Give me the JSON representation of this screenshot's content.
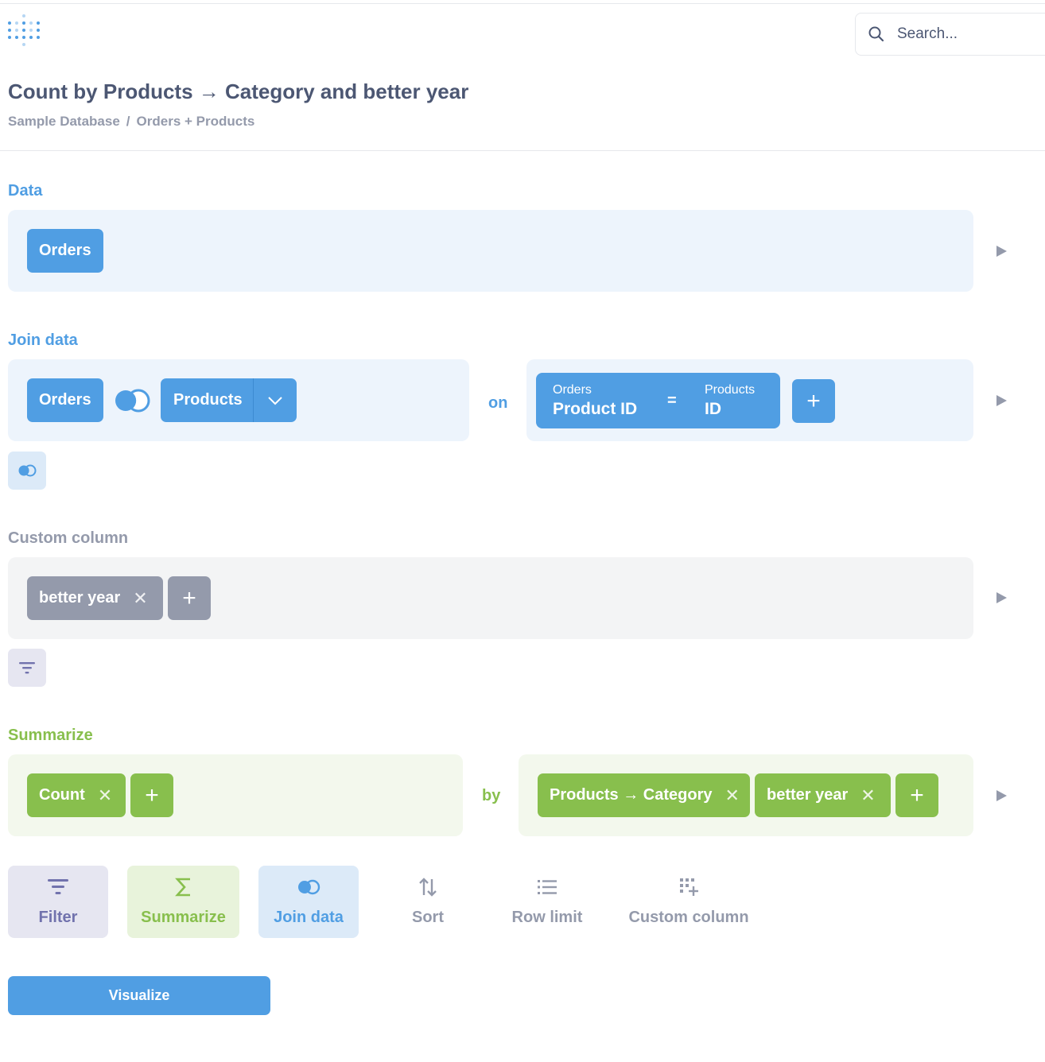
{
  "header": {
    "search_placeholder": "Search...",
    "title": "Count by Products → Category and better year",
    "breadcrumb": [
      "Sample Database",
      "/",
      "Orders + Products"
    ]
  },
  "data_section": {
    "label": "Data",
    "source": "Orders"
  },
  "join_section": {
    "label": "Join data",
    "left_table": "Orders",
    "right_table": "Products",
    "on_label": "on",
    "condition": {
      "left_table": "Orders",
      "left_field": "Product ID",
      "operator": "=",
      "right_table": "Products",
      "right_field": "ID"
    },
    "add_label": "+"
  },
  "custom_column_section": {
    "label": "Custom column",
    "columns": [
      "better year"
    ],
    "add_label": "+"
  },
  "summarize_section": {
    "label": "Summarize",
    "metrics": [
      "Count"
    ],
    "by_label": "by",
    "breakouts": [
      "Products → Category",
      "better year"
    ],
    "add_label": "+"
  },
  "actions": {
    "filter": "Filter",
    "summarize": "Summarize",
    "join": "Join data",
    "sort": "Sort",
    "row_limit": "Row limit",
    "custom_column": "Custom column"
  },
  "visualize_label": "Visualize",
  "icons": {
    "logo": "metabase-logo-icon",
    "search": "search-icon",
    "join": "join-icon",
    "chevron": "chevron-down-icon",
    "close": "close-icon",
    "add": "plus-icon",
    "filter": "filter-icon",
    "sum": "sigma-icon",
    "sort": "sort-icon",
    "list": "list-icon",
    "custom_column": "add-column-icon",
    "expand": "play-icon"
  },
  "colors": {
    "brand": "#509ee3",
    "summarize": "#88bf4d",
    "filter": "#7172ad",
    "neutral": "#949aab",
    "text": "#4c5773"
  }
}
